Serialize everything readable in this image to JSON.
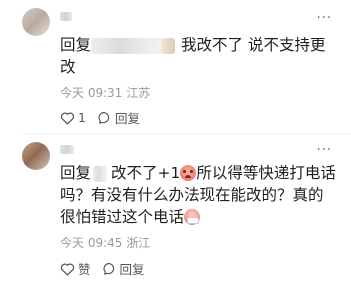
{
  "comments": [
    {
      "reply_prefix": "回复",
      "text": "我改不了 说不支持更改",
      "date": "今天 09:31",
      "location": "江苏",
      "like_count": "1",
      "reply_label": "回复",
      "more_label": "···"
    },
    {
      "reply_prefix": "回复",
      "text_a": "改不了+1",
      "text_b": "所以得等快递打电话吗？有没有什么办法现在能改的？真的很怕错过这个电话",
      "date": "今天 09:45",
      "location": "浙江",
      "like_label": "赞",
      "reply_label": "回复",
      "more_label": "···"
    }
  ]
}
